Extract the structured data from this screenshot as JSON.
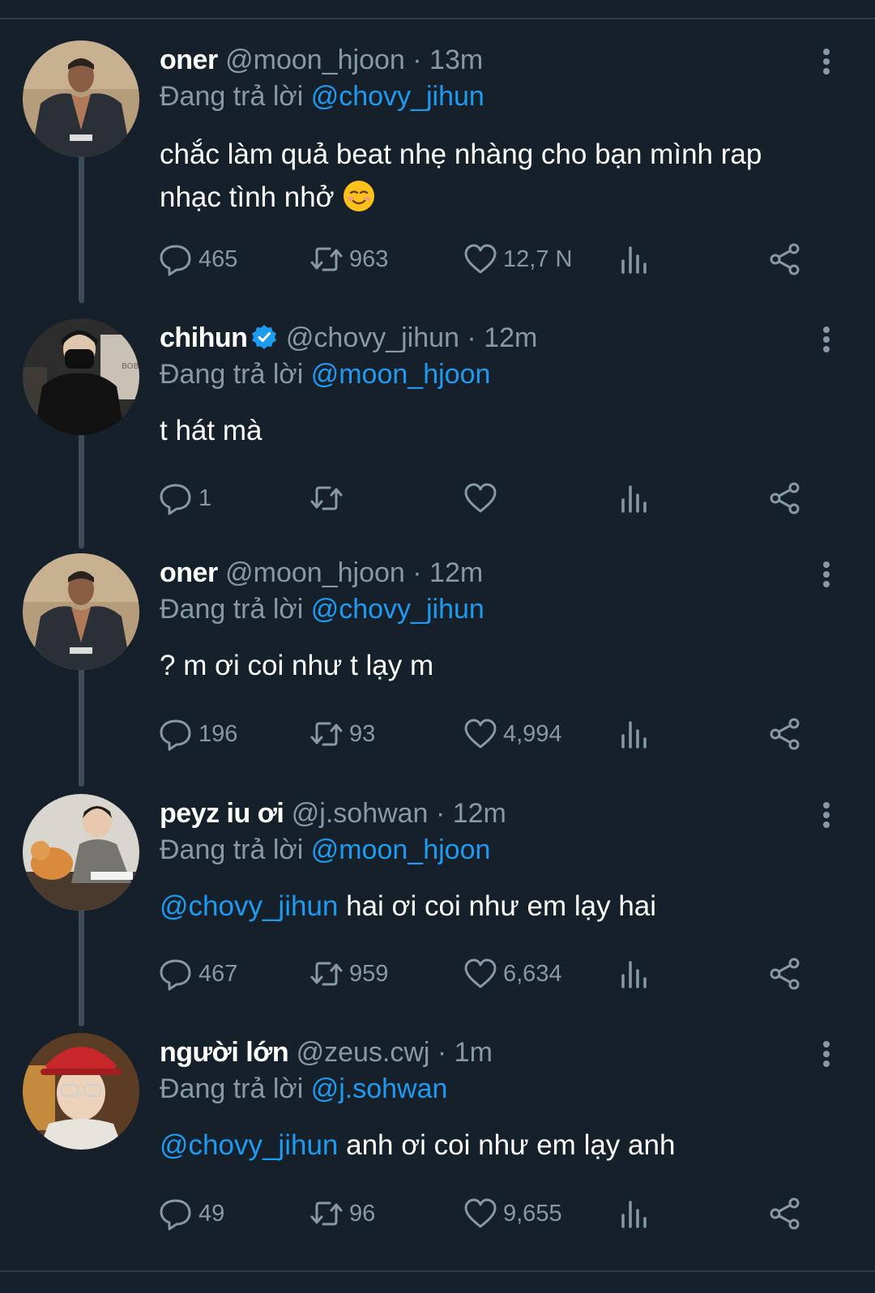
{
  "reply_prefix": "Đang trả lời",
  "colors": {
    "background": "#15202b",
    "text": "#ffffff",
    "muted": "#8899a6",
    "link": "#1d9bf0",
    "thread_line": "#3d4b58"
  },
  "tweets": [
    {
      "name": "oner",
      "handle": "@moon_hjoon",
      "time": "· 13m",
      "verified": false,
      "reply_to": "@chovy_jihun",
      "body_mention": "",
      "body_text_1": "chắc làm quả beat nhẹ nhàng cho bạn mình rap",
      "body_text_2": "nhạc tình nhở",
      "emoji": "smiling-face-icon",
      "replies": "465",
      "retweets": "963",
      "likes": "12,7 N"
    },
    {
      "name": "chihun",
      "handle": "@chovy_jihun",
      "time": "· 12m",
      "verified": true,
      "reply_to": "@moon_hjoon",
      "body_mention": "",
      "body_text_1": "t hát mà",
      "body_text_2": "",
      "replies": "1",
      "retweets": "",
      "likes": ""
    },
    {
      "name": "oner",
      "handle": "@moon_hjoon",
      "time": "· 12m",
      "verified": false,
      "reply_to": "@chovy_jihun",
      "body_mention": "",
      "body_text_1": "? m ơi coi như t lạy m",
      "body_text_2": "",
      "replies": "196",
      "retweets": "93",
      "likes": "4,994"
    },
    {
      "name": "peyz iu ơi",
      "handle": "@j.sohwan",
      "time": "· 12m",
      "verified": false,
      "reply_to": "@moon_hjoon",
      "body_mention": "@chovy_jihun",
      "body_text_1": " hai ơi coi như em lạy hai",
      "body_text_2": "",
      "replies": "467",
      "retweets": "959",
      "likes": "6,634"
    },
    {
      "name": "người lớn",
      "handle": "@zeus.cwj",
      "time": "· 1m",
      "verified": false,
      "reply_to": "@j.sohwan",
      "body_mention": "@chovy_jihun",
      "body_text_1": " anh ơi coi như em lạy anh",
      "body_text_2": "",
      "replies": "49",
      "retweets": "96",
      "likes": "9,655"
    }
  ]
}
